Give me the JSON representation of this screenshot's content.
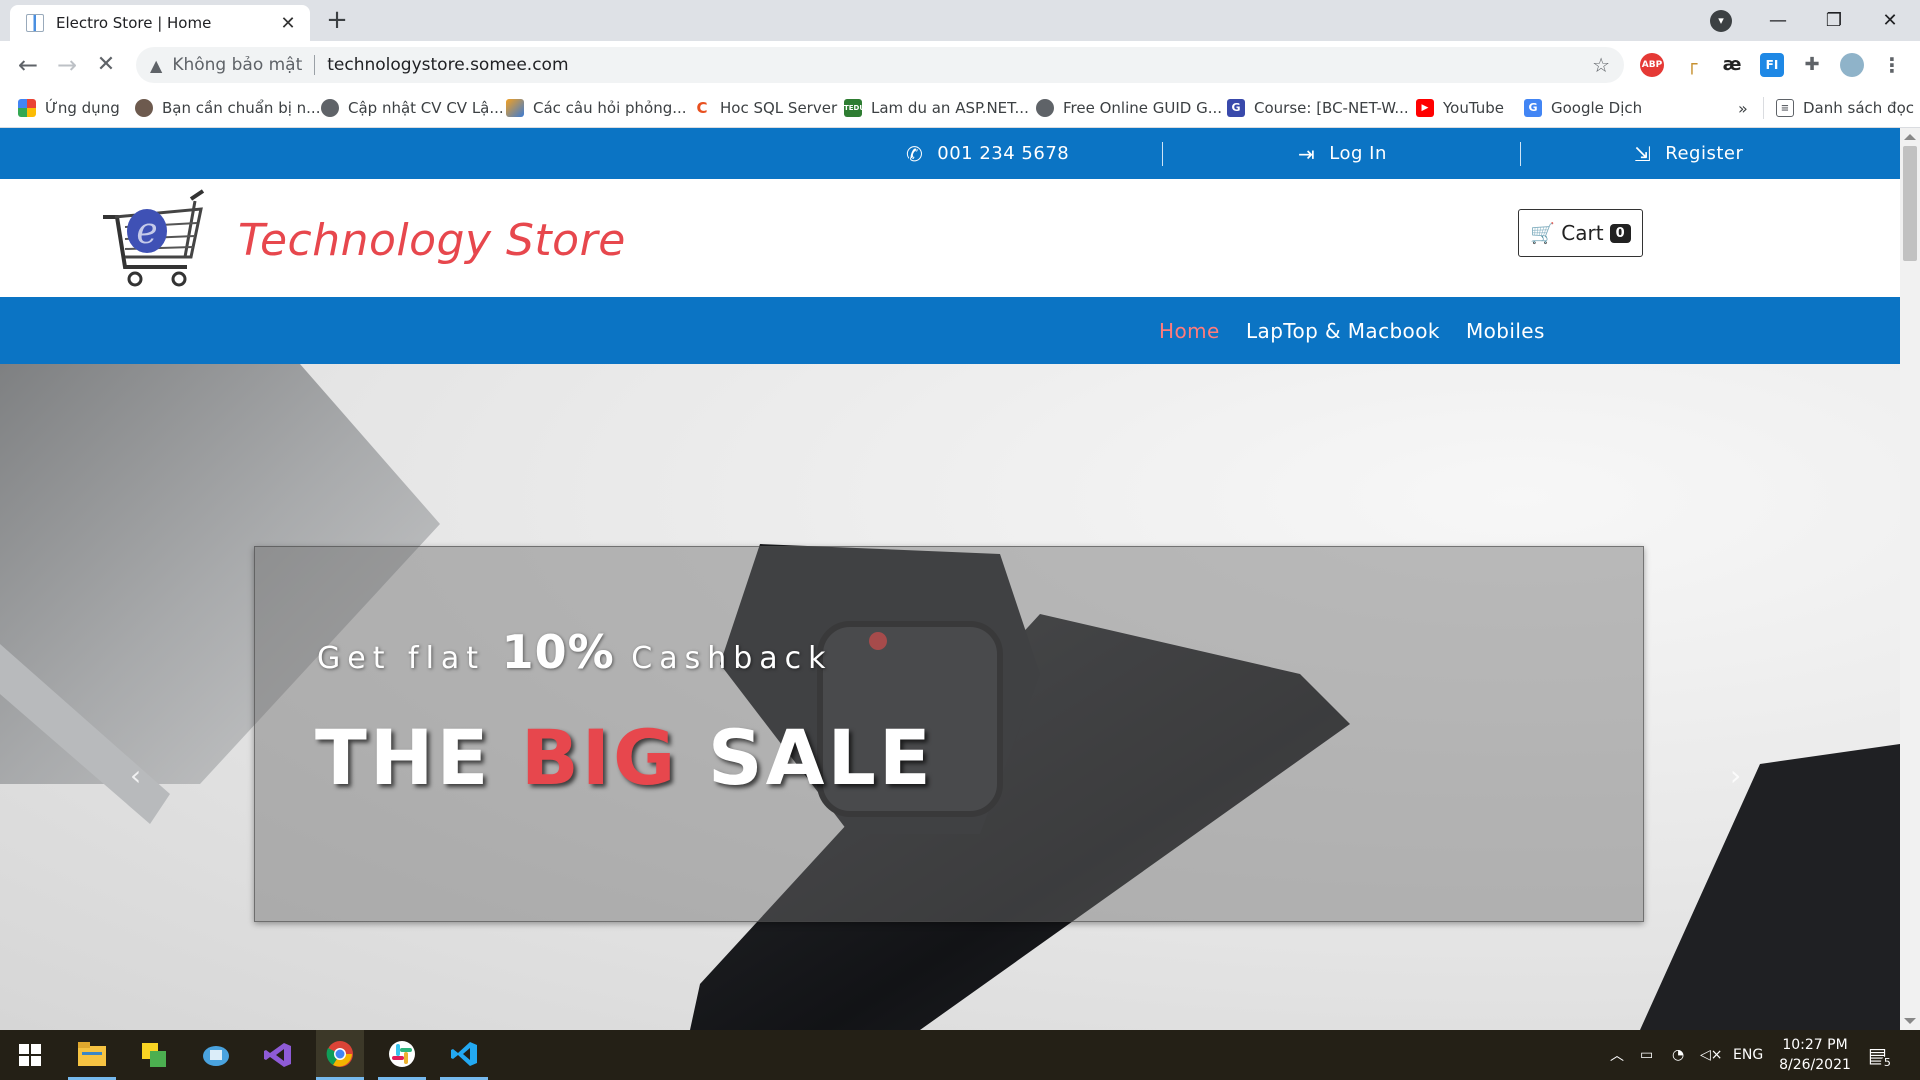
{
  "browser": {
    "tab_title": "Electro Store | Home",
    "tab_close": "✕",
    "new_tab": "+",
    "security_label": "Không bảo mật",
    "url": "technologystore.somee.com",
    "bookmarks": [
      {
        "label": "Ứng dụng",
        "icon": "apps-grid-icon"
      },
      {
        "label": "Bạn cần chuẩn bị n...",
        "icon": "avatar-icon"
      },
      {
        "label": "Cập nhật CV CV Lậ...",
        "icon": "globe-icon"
      },
      {
        "label": "Các câu hỏi phỏng...",
        "icon": "bird-icon"
      },
      {
        "label": "Hoc SQL Server",
        "icon": "c-logo-icon"
      },
      {
        "label": "Lam du an ASP.NET...",
        "icon": "site-icon"
      },
      {
        "label": "Free Online GUID G...",
        "icon": "globe-icon"
      },
      {
        "label": "Course: [BC-NET-W...",
        "icon": "g-logo-icon"
      },
      {
        "label": "YouTube",
        "icon": "youtube-icon"
      },
      {
        "label": "Google Dịch",
        "icon": "google-translate-icon"
      }
    ],
    "bookmarks_more": "»",
    "reading_list": "Danh sách đọc"
  },
  "site": {
    "topbar": {
      "phone": "001 234 5678",
      "login": "Log In",
      "register": "Register"
    },
    "title": "Technology Store",
    "cart_label": "Cart",
    "cart_count": "0",
    "nav": [
      "Home",
      "LapTop & Macbook",
      "Mobiles"
    ],
    "hero": {
      "cash_pre": "Get flat",
      "cash_pct": "10%",
      "cash_post": "Cashback",
      "sale_1": "THE",
      "sale_accent": "BIG",
      "sale_2": "SALE"
    },
    "colors": {
      "brand_blue": "#0b74c4",
      "accent_red": "#e7474d",
      "active_nav": "#ff7b7b"
    }
  },
  "taskbar": {
    "language": "ENG",
    "time": "10:27 PM",
    "date": "8/26/2021",
    "notification_count": "5"
  }
}
